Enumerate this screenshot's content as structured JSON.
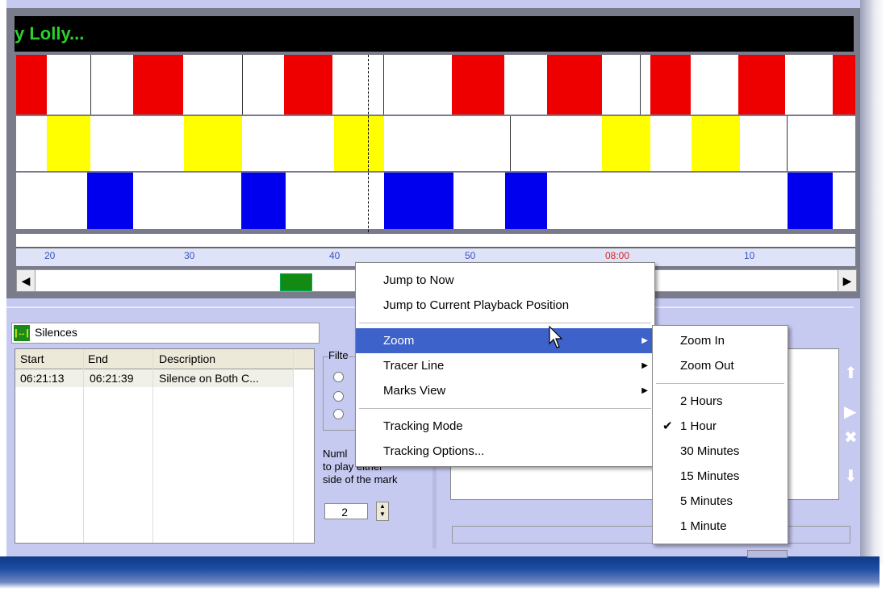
{
  "title": "y Lolly...",
  "ruler_ticks": [
    "20",
    "30",
    "40",
    "50",
    "08:00",
    "10"
  ],
  "panel": {
    "name": "Silences",
    "columns": [
      "Start",
      "End",
      "Description"
    ],
    "rows": [
      {
        "start": "06:21:13",
        "end": "06:21:39",
        "description": "Silence on Both C..."
      }
    ],
    "filter_label": "Filte",
    "number_label_line1": "Numl",
    "number_label_line2": "to play either",
    "number_label_line3": "side of the mark",
    "number_value": "2"
  },
  "context_menu": {
    "items": [
      {
        "label": "Jump to Now"
      },
      {
        "label": "Jump to Current Playback Position"
      },
      {
        "label": "Zoom",
        "submenu": true,
        "selected": true
      },
      {
        "label": "Tracer Line",
        "submenu": true
      },
      {
        "label": "Marks View",
        "submenu": true
      },
      {
        "label": "Tracking Mode"
      },
      {
        "label": "Tracking Options..."
      }
    ]
  },
  "zoom_submenu": {
    "items": [
      {
        "label": "Zoom In"
      },
      {
        "label": "Zoom Out"
      },
      {
        "label": "2 Hours"
      },
      {
        "label": "1 Hour",
        "checked": true
      },
      {
        "label": "30 Minutes"
      },
      {
        "label": "15 Minutes"
      },
      {
        "label": "5 Minutes"
      },
      {
        "label": "1 Minute"
      }
    ]
  },
  "colors": {
    "red": "#ee0000",
    "yellow": "#ffff00",
    "blue": "#0000ee",
    "green": "#138a13",
    "accent": "#3d62c9"
  }
}
